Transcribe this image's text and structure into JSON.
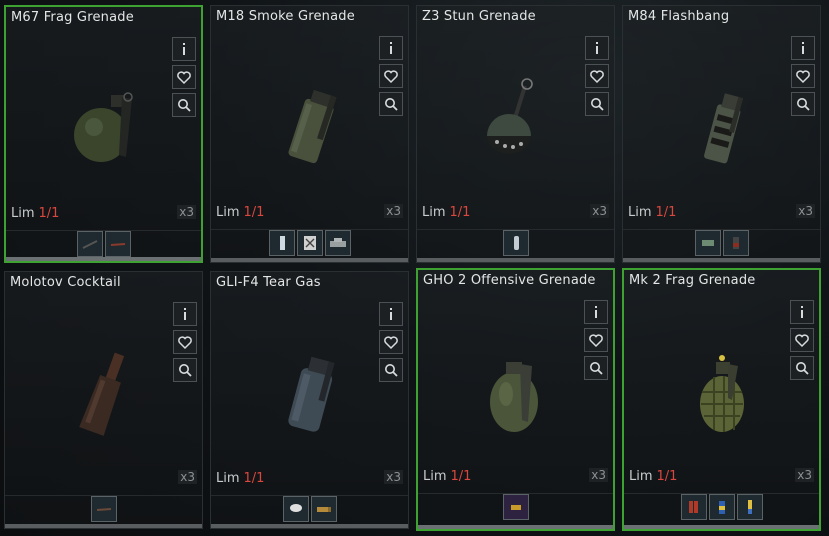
{
  "lim_label": "Lim",
  "cards": [
    {
      "name": "M67 Frag Grenade",
      "lim": "1/1",
      "qty": "x3",
      "selected": true,
      "icon": "frag-grenade-icon"
    },
    {
      "name": "M18 Smoke Grenade",
      "lim": "1/1",
      "qty": "x3",
      "selected": false,
      "icon": "smoke-grenade-icon"
    },
    {
      "name": "Z3 Stun Grenade",
      "lim": "1/1",
      "qty": "x3",
      "selected": false,
      "icon": "stun-grenade-icon"
    },
    {
      "name": "M84 Flashbang",
      "lim": "1/1",
      "qty": "x3",
      "selected": false,
      "icon": "flashbang-icon"
    },
    {
      "name": "Molotov Cocktail",
      "lim": "",
      "qty": "x3",
      "selected": false,
      "icon": "molotov-icon"
    },
    {
      "name": "GLI-F4 Tear Gas",
      "lim": "1/1",
      "qty": "x3",
      "selected": false,
      "icon": "tear-gas-icon"
    },
    {
      "name": "GHO 2 Offensive Grenade",
      "lim": "1/1",
      "qty": "x3",
      "selected": true,
      "icon": "offensive-grenade-icon"
    },
    {
      "name": "Mk 2 Frag Grenade",
      "lim": "1/1",
      "qty": "x3",
      "selected": true,
      "icon": "pineapple-grenade-icon"
    }
  ],
  "colors": {
    "selected_border": "#3ea233",
    "limit_value": "#d9473e"
  }
}
